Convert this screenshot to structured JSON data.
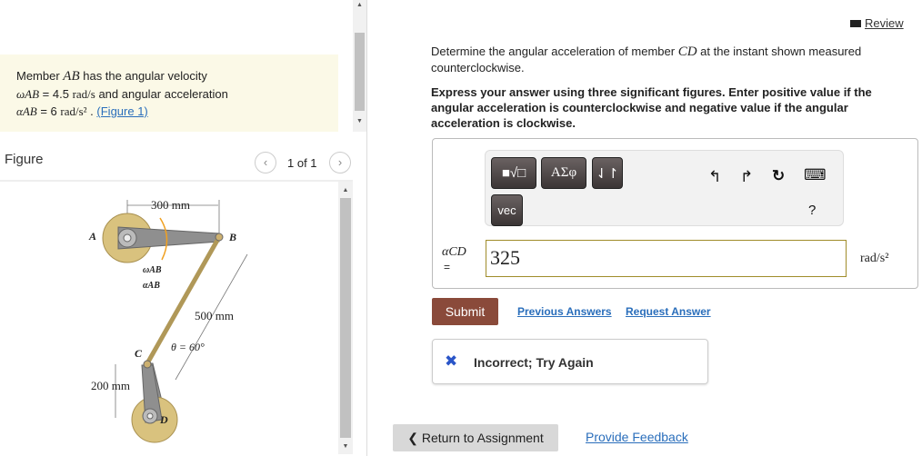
{
  "problem": {
    "line1_pre": "Member ",
    "line1_var": "AB",
    "line1_post": " has the angular velocity",
    "omega": "ωAB",
    "omega_val": " = 4.5 ",
    "omega_unit": "rad/s",
    "line2_post": " and angular acceleration",
    "alpha": "αAB",
    "alpha_val": " = 6 ",
    "alpha_unit": "rad/s²",
    "figure_link": "(Figure 1)"
  },
  "figure": {
    "heading": "Figure",
    "pager": "1 of 1",
    "labels": {
      "dim_ab": "300 mm",
      "dim_bc": "500 mm",
      "dim_cd": "200 mm",
      "theta": "θ = 60°",
      "a": "A",
      "b": "B",
      "c": "C",
      "d": "D",
      "omega": "ωAB",
      "alpha": "αAB"
    }
  },
  "review": "Review",
  "question": {
    "text_pre": "Determine the angular acceleration of member ",
    "var": "CD",
    "text_post": " at the instant shown measured counterclockwise.",
    "instructions": "Express your answer using three significant figures. Enter positive value if the angular acceleration is counterclockwise and negative value if the angular acceleration is clockwise."
  },
  "toolbar": {
    "templates": "■√□",
    "greek": "ΑΣφ",
    "arrows": "⇃↾",
    "vec": "vec",
    "undo": "↰",
    "redo": "↱",
    "reset": "↻",
    "keyboard": "⌨",
    "help": "?"
  },
  "answer": {
    "label": "αCD",
    "eq": "=",
    "value": "325",
    "unit": "rad/s²"
  },
  "actions": {
    "submit": "Submit",
    "previous": "Previous Answers",
    "request": "Request Answer"
  },
  "feedback": {
    "icon": "✖",
    "text": "Incorrect; Try Again"
  },
  "footer": {
    "return": "❮ Return to Assignment",
    "feedback": "Provide Feedback"
  },
  "colors": {
    "submit": "#8a4a3a",
    "link": "#2a6ebb",
    "error": "#2a55c8"
  }
}
